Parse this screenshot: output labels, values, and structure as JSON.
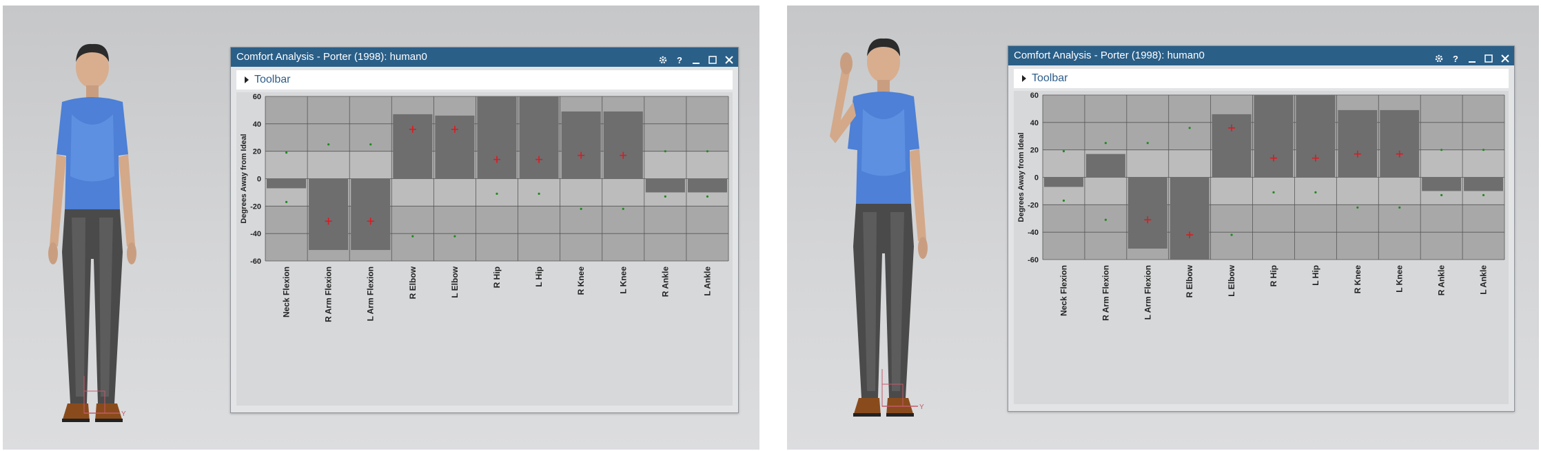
{
  "colors": {
    "titlebar": "#2a5f88",
    "bar": "#6e6e6e",
    "plot_background": "#a8a8a8",
    "plot_inner_band": "#bcbcbc",
    "limit_dot": "#1f8a1f",
    "current_cross": "#e01820",
    "toolbar_text": "#2d5d8a"
  },
  "panels": [
    {
      "window": {
        "title": "Comfort Analysis - Porter (1998): human0",
        "toolbar_label": "Toolbar",
        "icons": [
          "gear-icon",
          "help-icon",
          "minimize-icon",
          "maximize-icon",
          "close-icon"
        ]
      },
      "mannequin_pose": "arms down",
      "chart_data": {
        "type": "bar",
        "ylabel": "Degrees Away from Ideal",
        "ylim": [
          -60,
          60
        ],
        "yticks": [
          "60",
          "40",
          "20",
          "0",
          "-20",
          "-40",
          "-60"
        ],
        "categories": [
          "Neck Flexion",
          "R Arm Flexion",
          "L Arm Flexion",
          "R Elbow",
          "L Elbow",
          "R Hip",
          "L Hip",
          "R Knee",
          "L Knee",
          "R Ankle",
          "L Ankle"
        ],
        "values": [
          -7,
          -52,
          -52,
          47,
          46,
          60,
          60,
          49,
          49,
          -10,
          -10
        ],
        "current": [
          null,
          -31,
          -31,
          36,
          36,
          14,
          14,
          17,
          17,
          null,
          null
        ],
        "upper_limits": [
          19,
          25,
          25,
          null,
          null,
          null,
          null,
          null,
          null,
          20,
          20
        ],
        "lower_limits": [
          -17,
          null,
          null,
          -42,
          -42,
          -11,
          -11,
          -22,
          -22,
          -13,
          -13
        ],
        "grid": true
      }
    },
    {
      "window": {
        "title": "Comfort Analysis - Porter (1998): human0",
        "toolbar_label": "Toolbar",
        "icons": [
          "gear-icon",
          "help-icon",
          "minimize-icon",
          "maximize-icon",
          "close-icon"
        ]
      },
      "mannequin_pose": "right hand raised to head",
      "chart_data": {
        "type": "bar",
        "ylabel": "Degrees Away from Ideal",
        "ylim": [
          -60,
          60
        ],
        "yticks": [
          "60",
          "40",
          "20",
          "0",
          "-20",
          "-40",
          "-60"
        ],
        "categories": [
          "Neck Flexion",
          "R Arm Flexion",
          "L Arm Flexion",
          "R Elbow",
          "L Elbow",
          "R Hip",
          "L Hip",
          "R Knee",
          "L Knee",
          "R Ankle",
          "L Ankle"
        ],
        "values": [
          -7,
          17,
          -52,
          -60,
          46,
          60,
          60,
          49,
          49,
          -10,
          -10
        ],
        "current": [
          null,
          null,
          -31,
          -42,
          36,
          14,
          14,
          17,
          17,
          null,
          null
        ],
        "upper_limits": [
          19,
          25,
          25,
          36,
          null,
          null,
          null,
          null,
          null,
          20,
          20
        ],
        "lower_limits": [
          -17,
          -31,
          null,
          -42,
          -42,
          -11,
          -11,
          -22,
          -22,
          -13,
          -13
        ],
        "grid": true
      }
    }
  ]
}
